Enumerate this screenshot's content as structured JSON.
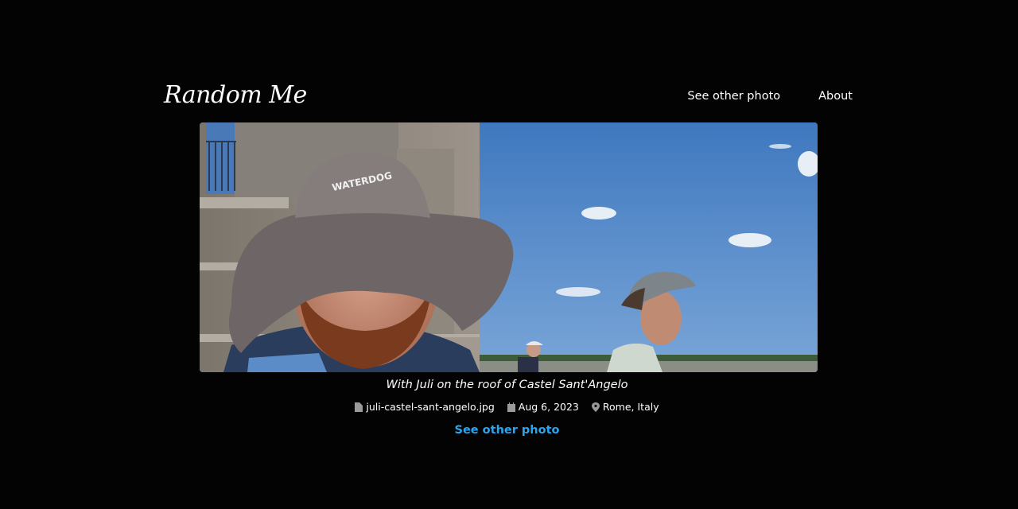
{
  "site": {
    "logo_text": "Random Me"
  },
  "nav": {
    "items": [
      {
        "label": "See other photo"
      },
      {
        "label": "About"
      }
    ]
  },
  "photo": {
    "caption": "With Juli on the roof of Castel Sant'Angelo",
    "hat_text": "WATERDOG"
  },
  "meta": {
    "filename": "juli-castel-sant-angelo.jpg",
    "date": "Aug 6, 2023",
    "location": "Rome, Italy",
    "icons": [
      "file-icon",
      "calendar-icon",
      "map-pin-icon"
    ]
  },
  "cta": {
    "label": "See other photo"
  },
  "colors": {
    "background": "#030303",
    "text": "#ffffff",
    "link_accent": "#2aa6f0",
    "meta_icon": "#9a9a9a"
  }
}
